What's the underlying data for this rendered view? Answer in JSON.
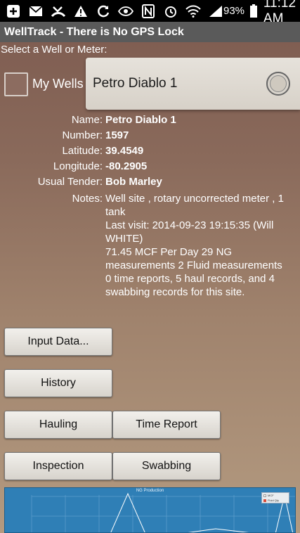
{
  "status_bar": {
    "icons": [
      "add-icon",
      "mail-icon",
      "missed-call-icon",
      "warning-icon",
      "sync-icon",
      "eye-icon",
      "nfc-icon",
      "alarm-icon",
      "wifi-icon",
      "signal-icon"
    ],
    "battery": "93%",
    "time": "11:12 AM"
  },
  "app": {
    "title": "WellTrack - There is No GPS Lock"
  },
  "selector": {
    "label": "Select a Well or Meter:",
    "my_wells_label": "My Wells",
    "selected_well": "Petro Diablo 1"
  },
  "details": {
    "name_label": "Name:",
    "name": "Petro Diablo 1",
    "number_label": "Number:",
    "number": "1597",
    "latitude_label": "Latitude:",
    "latitude": "39.4549",
    "longitude_label": "Longitude:",
    "longitude": "-80.2905",
    "tender_label": "Usual Tender:",
    "tender": "Bob Marley",
    "notes_label": "Notes:",
    "notes_lines": [
      "Well site , rotary uncorrected meter , 1 tank",
      "Last visit: 2014-09-23 19:15:35 (Will WHITE)",
      "71.45 MCF Per Day 29 NG measurements 2 Fluid measurements",
      "0 time reports, 5 haul records, and 4 swabbing records for this site."
    ]
  },
  "buttons": {
    "input_data": "Input Data...",
    "history": "History",
    "hauling": "Hauling",
    "time_report": "Time Report",
    "inspection": "Inspection",
    "swabbing": "Swabbing"
  },
  "chart_data": {
    "type": "line",
    "title": "NG Production",
    "legend": [
      "MCF",
      "Fluid Qty"
    ],
    "colors": {
      "background": "#2f7fb6",
      "MCF": "#ffffff",
      "Fluid Qty": "#d94c3a"
    }
  }
}
